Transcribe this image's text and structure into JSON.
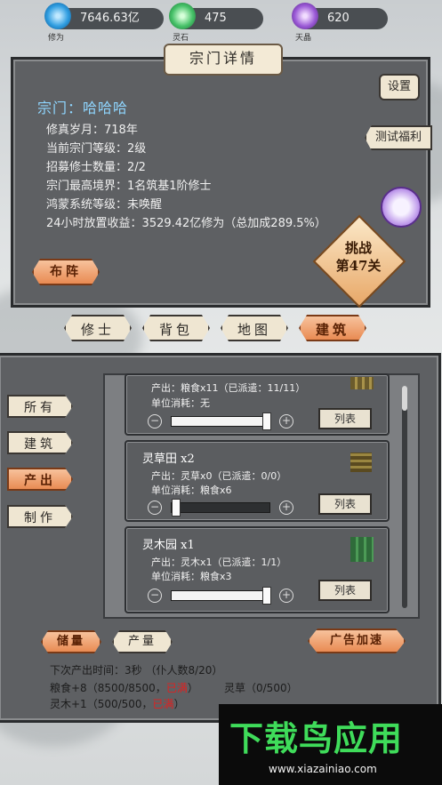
{
  "resources": [
    {
      "label": "修为",
      "value": "7646.63亿",
      "color": "#3aa7e8",
      "icon": "blue-flame-icon"
    },
    {
      "label": "灵石",
      "value": "475",
      "color": "#4cc36b",
      "icon": "green-crystal-icon"
    },
    {
      "label": "天晶",
      "value": "620",
      "color": "#9b5ad6",
      "icon": "purple-crystal-icon"
    }
  ],
  "sect": {
    "panel_title": "宗门详情",
    "name": "宗门：哈哈哈",
    "lines": [
      "修真岁月：718年",
      "当前宗门等级：2级",
      "招募修士数量：2/2",
      "宗门最高境界：1名筑基1阶修士",
      "鸿蒙系统等级：未唤醒",
      "24小时放置收益：3529.42亿修为（总加成289.5%）"
    ],
    "settings_btn": "设置",
    "test_bonus_btn": "测试福利",
    "formation_btn": "布阵",
    "challenge_line1": "挑战",
    "challenge_line2": "第47关"
  },
  "tabs": [
    {
      "label": "修士",
      "active": false
    },
    {
      "label": "背包",
      "active": false
    },
    {
      "label": "地图",
      "active": false
    },
    {
      "label": "建筑",
      "active": true
    }
  ],
  "side_tabs": [
    {
      "label": "所有",
      "active": false
    },
    {
      "label": "建筑",
      "active": false
    },
    {
      "label": "产出",
      "active": true
    },
    {
      "label": "制作",
      "active": false
    }
  ],
  "buildings": [
    {
      "title": "",
      "line1": "产出：粮食x11（已派遣：11/11）",
      "line2": "单位消耗：无",
      "level": 1.0,
      "list": "列表"
    },
    {
      "title": "灵草田 x2",
      "line1": "产出：灵草x0（已派遣：0/0）",
      "line2": "单位消耗：粮食x6",
      "level": 0.0,
      "list": "列表"
    },
    {
      "title": "灵木园 x1",
      "line1": "产出：灵木x1（已派遣：1/1）",
      "line2": "单位消耗：粮食x3",
      "level": 1.0,
      "list": "列表"
    }
  ],
  "bottom": {
    "storage_btn": "储量",
    "output_btn": "产量",
    "ad_btn": "广告加速",
    "next_output": "下次产出时间：3秒 （仆人数8/20）",
    "food": "粮食+8（8500/8500，",
    "food_full": "已满",
    "food_end": "）",
    "herb": "灵草（0/500）",
    "wood": "灵木+1（500/500，",
    "wood_full": "已满",
    "wood_end": "）"
  },
  "watermark": {
    "brand": "下载鸟应用",
    "url": "www.xiazainiao.com"
  }
}
